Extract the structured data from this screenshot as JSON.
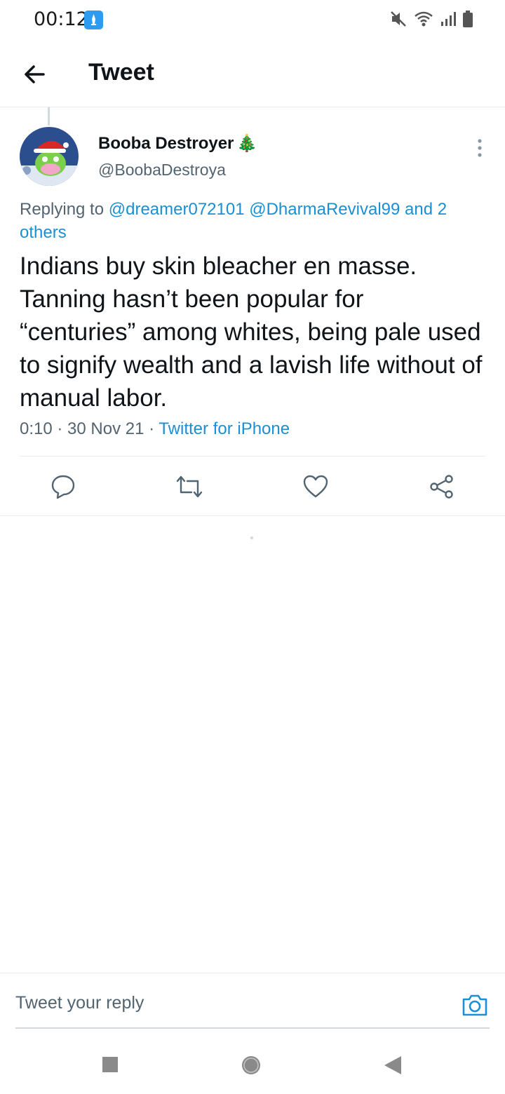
{
  "status_bar": {
    "time": "00:12",
    "icons": [
      "launcher-app-icon",
      "mute-icon",
      "wifi-icon",
      "signal-icon",
      "battery-icon"
    ]
  },
  "header": {
    "back_icon": "arrow-left-icon",
    "title": "Tweet"
  },
  "tweet": {
    "display_name": "Booba Destroyer",
    "display_name_emoji": "🎄",
    "handle": "@BoobaDestroya",
    "replying_prefix": "Replying to",
    "replying_to": "@dreamer072101 @DharmaRevival99 and 2 others",
    "text": "Indians buy skin bleacher en masse. Tanning hasn’t been popular for “centuries” among whites, being pale used to signify wealth and a lavish life without of manual labor.",
    "timestamp": "0:10 · 30 Nov 21 · ",
    "source": "Twitter for iPhone",
    "actions": [
      "reply-icon",
      "retweet-icon",
      "like-icon",
      "share-icon"
    ]
  },
  "reply_bar": {
    "placeholder": "Tweet your reply",
    "camera_icon": "camera-icon"
  },
  "nav_bar": {
    "buttons": [
      "recents-square-icon",
      "home-circle-icon",
      "back-triangle-icon"
    ]
  },
  "colors": {
    "accent": "#1b8fd4",
    "secondary_text": "#536471",
    "primary_text": "#0f1419",
    "divider": "#e6ecf0"
  }
}
